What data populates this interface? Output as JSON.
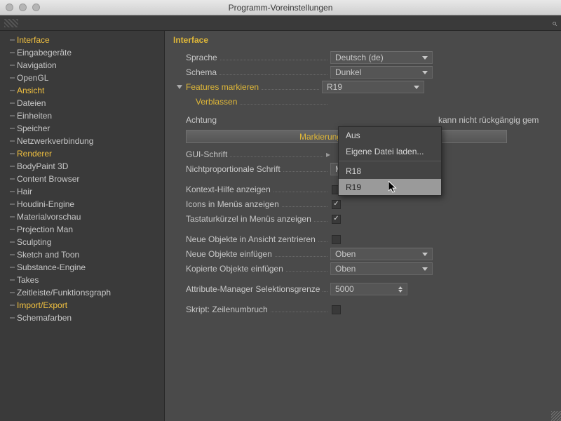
{
  "window": {
    "title": "Programm-Voreinstellungen"
  },
  "sidebar": {
    "items": [
      {
        "label": "Interface",
        "highlight": true
      },
      {
        "label": "Eingabegeräte"
      },
      {
        "label": "Navigation"
      },
      {
        "label": "OpenGL"
      },
      {
        "label": "Ansicht",
        "highlight": true
      },
      {
        "label": "Dateien"
      },
      {
        "label": "Einheiten"
      },
      {
        "label": "Speicher"
      },
      {
        "label": "Netzwerkverbindung"
      },
      {
        "label": "Renderer",
        "highlight": true
      },
      {
        "label": "BodyPaint 3D"
      },
      {
        "label": "Content Browser"
      },
      {
        "label": "Hair"
      },
      {
        "label": "Houdini-Engine"
      },
      {
        "label": "Materialvorschau"
      },
      {
        "label": "Projection Man"
      },
      {
        "label": "Sculpting"
      },
      {
        "label": "Sketch and Toon"
      },
      {
        "label": "Substance-Engine"
      },
      {
        "label": "Takes"
      },
      {
        "label": "Zeitleiste/Funktionsgraph"
      },
      {
        "label": "Import/Export",
        "highlight": true
      },
      {
        "label": "Schemafarben"
      }
    ]
  },
  "panel": {
    "title": "Interface",
    "language": {
      "label": "Sprache",
      "value": "Deutsch (de)"
    },
    "scheme": {
      "label": "Schema",
      "value": "Dunkel"
    },
    "features": {
      "label": "Features markieren",
      "value": "R19"
    },
    "fade": {
      "label": "Verblassen"
    },
    "warning": {
      "label": "Achtung",
      "text": "kann nicht rückgängig gem"
    },
    "reset_button": "Markierung zurücksetzen",
    "gui_font": {
      "label": "GUI-Schrift"
    },
    "mono_font": {
      "label": "Nichtproportionale Schrift",
      "value": "Monaco"
    },
    "context_help": {
      "label": "Kontext-Hilfe anzeigen",
      "value": false
    },
    "icons_menus": {
      "label": "Icons in Menüs anzeigen",
      "value": true
    },
    "shortcuts_menus": {
      "label": "Tastaturkürzel in Menüs anzeigen",
      "value": true
    },
    "center_new": {
      "label": "Neue Objekte in Ansicht zentrieren",
      "value": false
    },
    "insert_new": {
      "label": "Neue Objekte einfügen",
      "value": "Oben"
    },
    "insert_copied": {
      "label": "Kopierte Objekte einfügen",
      "value": "Oben"
    },
    "attr_limit": {
      "label": "Attribute-Manager Selektionsgrenze",
      "value": "5000"
    },
    "script_wrap": {
      "label": "Skript: Zeilenumbruch",
      "value": false
    }
  },
  "dropdown": {
    "items": [
      "Aus",
      "Eigene Datei laden...",
      "R18",
      "R19"
    ],
    "hover_index": 3
  }
}
